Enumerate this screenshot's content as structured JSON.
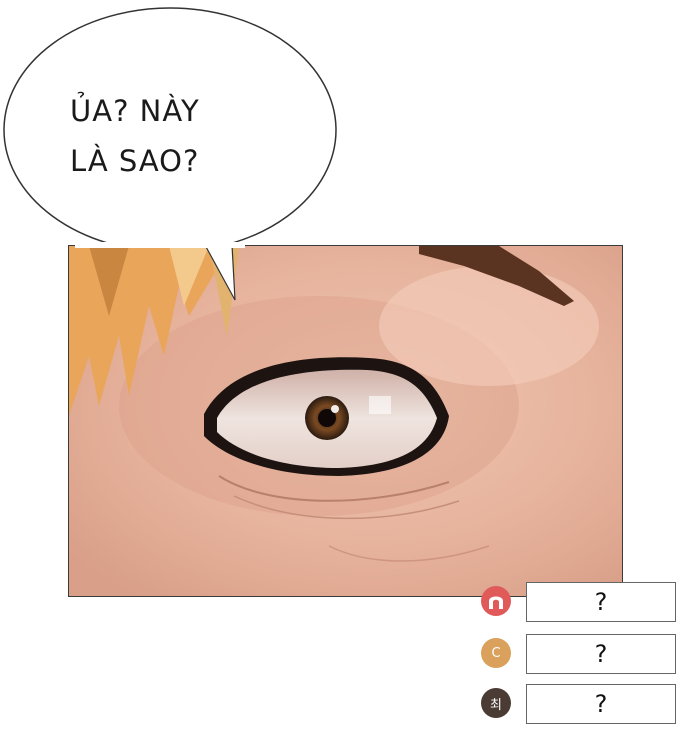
{
  "speech_bubble": {
    "line1": "ỦA? NÀY",
    "line2": "LÀ SAO?"
  },
  "reactions": [
    {
      "icon": "",
      "value": "?",
      "color": "#e05a5a"
    },
    {
      "icon": "C",
      "value": "?",
      "color": "#d9a15c"
    },
    {
      "icon": "최",
      "value": "?",
      "color": "#4a3b34"
    }
  ]
}
